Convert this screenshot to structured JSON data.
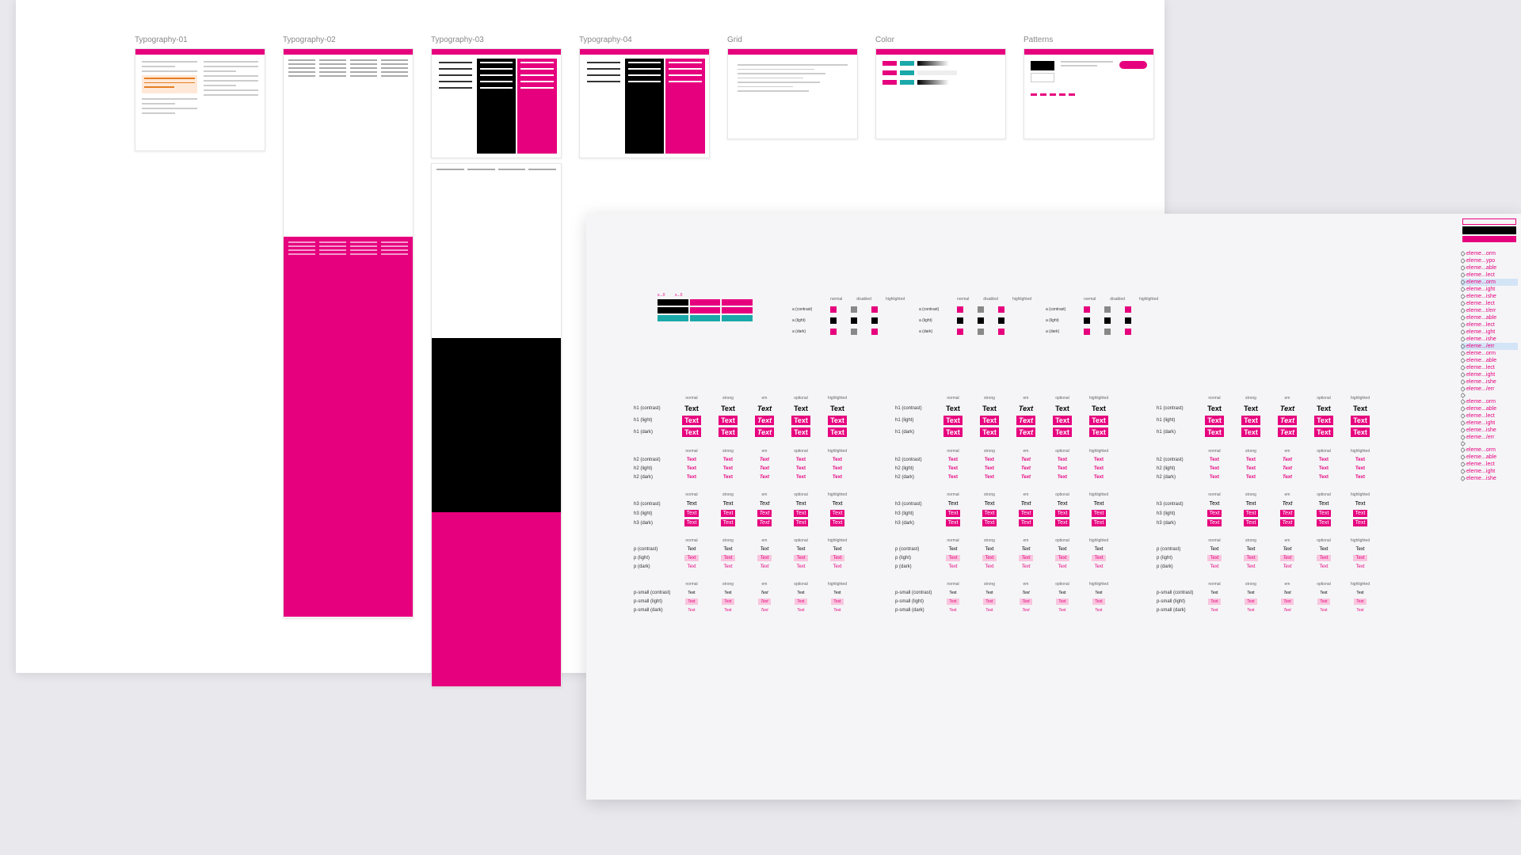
{
  "artboards": {
    "typography01": "Typography-01",
    "typography02": "Typography-02",
    "typography03": "Typography-03",
    "typography04": "Typography-04",
    "grid": "Grid",
    "color": "Color",
    "patterns": "Patterns"
  },
  "colors": {
    "brand_pink": "#e6007e",
    "black": "#000000",
    "teal": "#1ba8a8",
    "gray": "#888888"
  },
  "swatch_headers": [
    "normal",
    "disabled",
    "highlighted"
  ],
  "swatch_rows": [
    "a (contrast)",
    "a (light)",
    "a (dark)"
  ],
  "text_table": {
    "col_headers": [
      "normal",
      "strong",
      "em",
      "optional",
      "highlighted"
    ],
    "sample": "Text",
    "row_groups": [
      {
        "rows": [
          {
            "label": "h1 (contrast)",
            "style": "h1"
          },
          {
            "label": "h1 (light)",
            "style": "h1",
            "bg": true
          },
          {
            "label": "h1 (dark)",
            "style": "h1",
            "bg": true
          }
        ]
      },
      {
        "rows": [
          {
            "label": "h2 (contrast)",
            "style": "h2",
            "pink": true
          },
          {
            "label": "h2 (light)",
            "style": "h2",
            "pink": true
          },
          {
            "label": "h2 (dark)",
            "style": "h2",
            "pink": true
          }
        ]
      },
      {
        "rows": [
          {
            "label": "h3 (contrast)",
            "style": "h3"
          },
          {
            "label": "h3 (light)",
            "style": "h3",
            "bg": true
          },
          {
            "label": "h3 (dark)",
            "style": "h3",
            "bg": true
          }
        ]
      },
      {
        "rows": [
          {
            "label": "p (contrast)",
            "style": "p"
          },
          {
            "label": "p (light)",
            "style": "p",
            "bgl": true
          },
          {
            "label": "p (dark)",
            "style": "p",
            "pink": true
          }
        ]
      },
      {
        "rows": [
          {
            "label": "p-small (contrast)",
            "style": "ps"
          },
          {
            "label": "p-small (light)",
            "style": "ps",
            "bgl": true
          },
          {
            "label": "p-small (dark)",
            "style": "ps",
            "pink": true
          }
        ]
      }
    ]
  },
  "spec": {
    "s1": "s...0",
    "s2": "s...0"
  },
  "layers": [
    "eleme...orm",
    "eleme...ypo",
    "eleme...able",
    "eleme...lect",
    "eleme...orm",
    "eleme...ight",
    "eleme...ishe",
    "eleme...lect",
    "eleme...t/err",
    "eleme...able",
    "eleme...lect",
    "eleme...ight",
    "eleme...ishe",
    "eleme.../err",
    "eleme...orm",
    "eleme...able",
    "eleme...lect",
    "eleme...ight",
    "eleme...ishe",
    "eleme.../err",
    "",
    "eleme...orm",
    "eleme...able",
    "eleme...lect",
    "eleme...ight",
    "eleme...ishe",
    "eleme.../err",
    "",
    "eleme...orm",
    "eleme...able",
    "eleme...lect",
    "eleme...ight",
    "eleme...ishe"
  ]
}
